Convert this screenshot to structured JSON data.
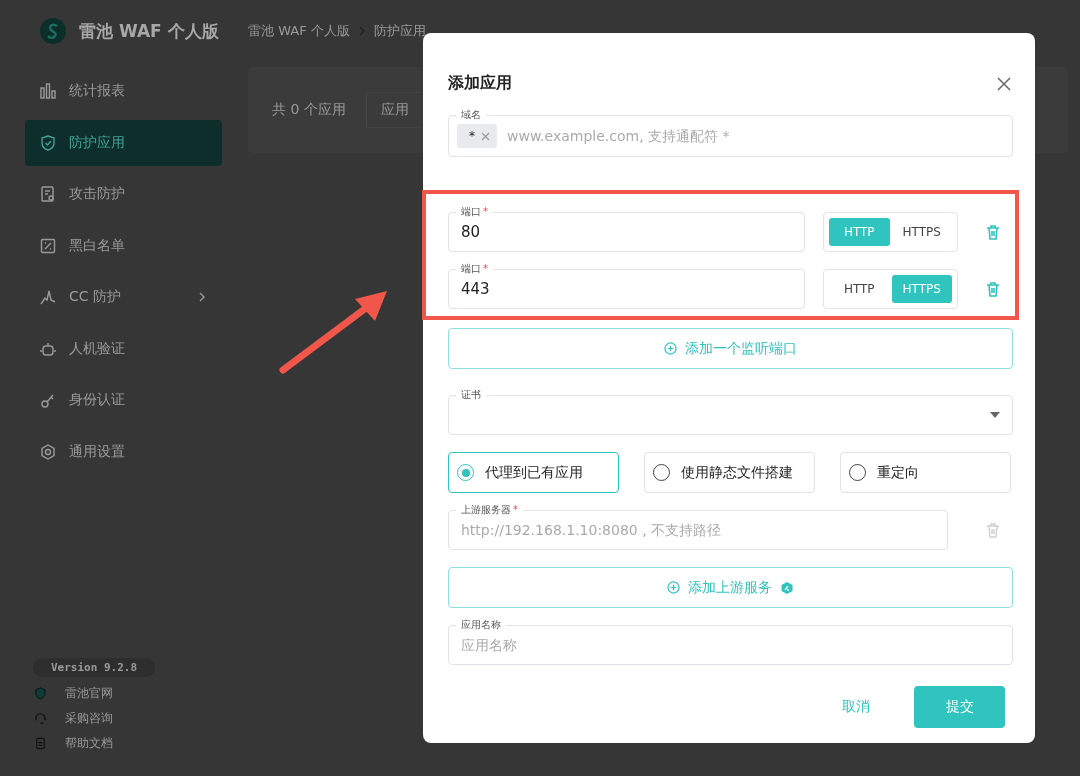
{
  "brand": {
    "title": "雷池 WAF 个人版"
  },
  "sidebar": {
    "items": [
      {
        "label": "统计报表",
        "selected": false,
        "submenu": false
      },
      {
        "label": "防护应用",
        "selected": true,
        "submenu": false
      },
      {
        "label": "攻击防护",
        "selected": false,
        "submenu": false
      },
      {
        "label": "黑白名单",
        "selected": false,
        "submenu": false
      },
      {
        "label": "CC 防护",
        "selected": false,
        "submenu": true
      },
      {
        "label": "人机验证",
        "selected": false,
        "submenu": false
      },
      {
        "label": "身份认证",
        "selected": false,
        "submenu": false
      },
      {
        "label": "通用设置",
        "selected": false,
        "submenu": false
      }
    ],
    "version": "Version 9.2.8",
    "links": [
      "雷池官网",
      "采购咨询",
      "帮助文档"
    ]
  },
  "breadcrumb": [
    "雷池 WAF 个人版",
    "防护应用"
  ],
  "toolbar": {
    "count": "共 0 个应用",
    "filter": "应用"
  },
  "dialog": {
    "title": "添加应用",
    "domain": {
      "label": "域名",
      "tags": [
        "*"
      ],
      "placeholder": "www.example.com, 支持通配符 *"
    },
    "ports": [
      {
        "label": "端口",
        "required": true,
        "value": "80",
        "protocols": [
          {
            "label": "HTTP",
            "selected": true
          },
          {
            "label": "HTTPS",
            "selected": false
          }
        ]
      },
      {
        "label": "端口",
        "required": true,
        "value": "443",
        "protocols": [
          {
            "label": "HTTP",
            "selected": false
          },
          {
            "label": "HTTPS",
            "selected": true
          }
        ]
      }
    ],
    "add_port": "添加一个监听端口",
    "certificate": {
      "label": "证书"
    },
    "modes": [
      {
        "label": "代理到已有应用",
        "selected": true
      },
      {
        "label": "使用静态文件搭建",
        "selected": false
      },
      {
        "label": "重定向",
        "selected": false
      }
    ],
    "upstream": {
      "label": "上游服务器",
      "required": true,
      "placeholder": "http://192.168.1.10:8080 , 不支持路径",
      "delete_disabled": true
    },
    "add_upstream": "添加上游服务",
    "app_name": {
      "label": "应用名称",
      "placeholder": "应用名称"
    },
    "cancel": "取消",
    "submit": "提交"
  }
}
